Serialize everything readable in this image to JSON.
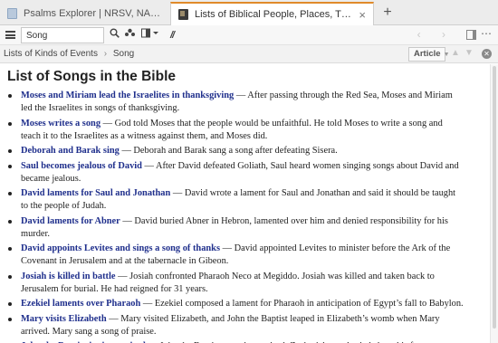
{
  "tabs": [
    {
      "label": "Psalms Explorer | NRSV, NABRE:RE Notes",
      "icon": "document-icon",
      "active": false
    },
    {
      "label": "Lists of Biblical People, Places, Things, and Events",
      "icon": "book-icon",
      "active": true,
      "close": "×"
    }
  ],
  "new_tab_label": "+",
  "toolbar": {
    "search_value": "Song",
    "search_placeholder": "Search",
    "parallel_label": "//",
    "nav_arrows": "‹ ›",
    "more_label": "⋯"
  },
  "breadcrumb": {
    "items": [
      "Lists of Kinds of Events",
      "Song"
    ],
    "separator": "›"
  },
  "article_button": {
    "label": "Article",
    "caret": "▼"
  },
  "article": {
    "title": "List of Songs in the Bible",
    "items": [
      {
        "link": "Moses and Miriam lead the Israelites in thanksgiving",
        "lines": [
          " — After passing through the Red Sea, Moses and Miriam",
          "led the Israelites in songs of thanksgiving."
        ]
      },
      {
        "link": "Moses writes a song",
        "lines": [
          " — God told Moses that the people would be unfaithful. He told Moses to write a song and",
          "teach it to the Israelites as a witness against them, and Moses did."
        ]
      },
      {
        "link": "Deborah and Barak sing",
        "lines": [
          " — Deborah and Barak sang a song after defeating Sisera."
        ]
      },
      {
        "link": "Saul becomes jealous of David",
        "lines": [
          " — After David defeated Goliath, Saul heard women singing songs about David and",
          "became jealous."
        ]
      },
      {
        "link": "David laments for Saul and Jonathan",
        "lines": [
          " — David wrote a lament for Saul and Jonathan and said it should be taught",
          "to the people of Judah."
        ]
      },
      {
        "link": "David laments for Abner",
        "lines": [
          " — David buried Abner in Hebron, lamented over him and denied responsibility for his",
          "murder."
        ]
      },
      {
        "link": "David appoints Levites and sings a song of thanks",
        "lines": [
          " — David appointed Levites to minister before the Ark of the",
          "Covenant in Jerusalem and at the tabernacle in Gibeon."
        ]
      },
      {
        "link": "Josiah is killed in battle",
        "lines": [
          " — Josiah confronted Pharaoh Neco at Megiddo. Josiah was killed and taken back to",
          "Jerusalem for burial. He had reigned for 31 years."
        ]
      },
      {
        "link": "Ezekiel laments over Pharaoh",
        "lines": [
          " — Ezekiel composed a lament for Pharaoh in anticipation of Egypt’s fall to Babylon."
        ]
      },
      {
        "link": "Mary visits Elizabeth",
        "lines": [
          " — Mary visited Elizabeth, and John the Baptist leaped in Elizabeth’s womb when Mary",
          "arrived. Mary sang a song of praise."
        ]
      },
      {
        "link": "John the Baptist is circumcised",
        "lines": [
          " — John the Baptist was circumcised. Zechariah prophesied about his future career."
        ]
      }
    ]
  },
  "colors": {
    "link": "#1f2f8c",
    "active_tab_accent": "#e08a2a",
    "text": "#222222"
  }
}
